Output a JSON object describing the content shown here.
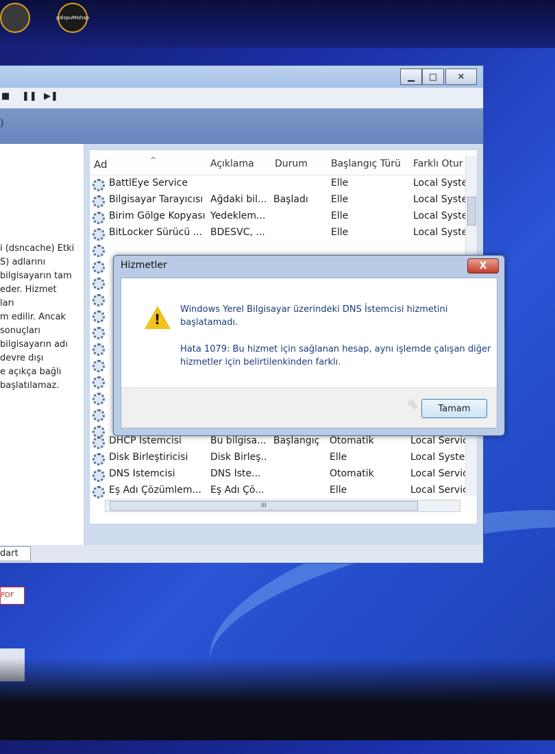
{
  "desktop": {
    "icon_label": "gdispuMishap"
  },
  "services_window": {
    "toolbar_glyphs": [
      "■",
      "❚❚",
      "▶❚"
    ],
    "nav_fragment": ")",
    "description_lines": [
      "i (dsncache) Etki",
      "S) adlarını",
      "bilgisayarın tam",
      "eder. Hizmet",
      "ları",
      "m edilir. Ancak",
      "sonuçları",
      "bilgisayarın adı",
      "devre dışı",
      "e açıkça bağlı",
      "başlatılamaz."
    ],
    "columns": [
      "Ad",
      "Açıklama",
      "Durum",
      "Başlangıç Türü",
      "Farklı Oturur"
    ],
    "rows": [
      {
        "name": "BattlEye Service",
        "desc": "",
        "status": "",
        "startup": "Elle",
        "logon": "Local System"
      },
      {
        "name": "Bilgisayar Tarayıcısı",
        "desc": "Ağdaki bil...",
        "status": "Başladı",
        "startup": "Elle",
        "logon": "Local System"
      },
      {
        "name": "Birim Gölge Kopyası",
        "desc": "Yedeklem...",
        "status": "",
        "startup": "Elle",
        "logon": "Local System"
      },
      {
        "name": "BitLocker Sürücü ...",
        "desc": "BDESVC, ...",
        "status": "",
        "startup": "Elle",
        "logon": "Local System"
      },
      {
        "name": "DHCP İstemcisi",
        "desc": "Bu bilgisa...",
        "status": "Başlangıç",
        "startup": "Otomatik",
        "logon": "Local Service"
      },
      {
        "name": "Disk Birleştiricisi",
        "desc": "Disk Birleş...",
        "status": "",
        "startup": "Elle",
        "logon": "Local System"
      },
      {
        "name": "DNS İstemcisi",
        "desc": "DNS İste...",
        "status": "",
        "startup": "Otomatik",
        "logon": "Local Service"
      },
      {
        "name": "Eş Adı Çözümlem...",
        "desc": "Eş Adı Çö...",
        "status": "",
        "startup": "Elle",
        "logon": "Local Service"
      }
    ],
    "hscroll_grip": "III",
    "status_tab": "dart"
  },
  "dialog": {
    "title": "Hizmetler",
    "close_label": "X",
    "message_line1": "Windows Yerel Bilgisayar üzerindeki DNS İstemcisi hizmetini",
    "message_line2": "başlatamadı.",
    "error_line1": "Hata 1079: Bu hizmet için sağlanan hesap, aynı işlemde çalışan diğer",
    "error_line2": "hizmetler için belirtilenkinden farklı.",
    "ok_label": "Tamam"
  },
  "taskbar": {
    "pdf_label": "PDF"
  }
}
